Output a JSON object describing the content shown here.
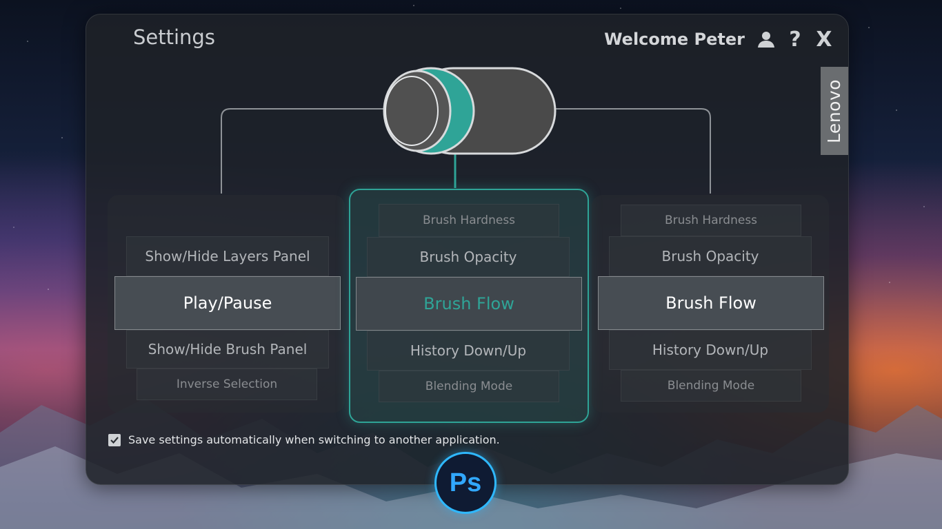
{
  "header": {
    "title": "Settings",
    "welcome": "Welcome Peter",
    "help_glyph": "?",
    "close_glyph": "X",
    "icons": [
      "user-icon",
      "help-icon",
      "close-icon"
    ]
  },
  "brand": {
    "logo_text": "Lenovo"
  },
  "dial": {
    "accent_color": "#2fa497",
    "body_color": "#4a4a4a"
  },
  "columns": {
    "left": {
      "items": [
        {
          "label": "Show/Hide Layers Panel"
        },
        {
          "label": "Play/Pause"
        },
        {
          "label": "Show/Hide Brush Panel"
        },
        {
          "label": "Inverse Selection"
        }
      ],
      "selected_index": 1
    },
    "center": {
      "items": [
        {
          "label": "Brush Hardness"
        },
        {
          "label": "Brush Opacity"
        },
        {
          "label": "Brush Flow"
        },
        {
          "label": "History Down/Up"
        },
        {
          "label": "Blending Mode"
        }
      ],
      "selected_index": 2,
      "active": true
    },
    "right": {
      "items": [
        {
          "label": "Brush Hardness"
        },
        {
          "label": "Brush Opacity"
        },
        {
          "label": "Brush Flow"
        },
        {
          "label": "History Down/Up"
        },
        {
          "label": "Blending Mode"
        }
      ],
      "selected_index": 2
    }
  },
  "autosave": {
    "checked": true,
    "label": "Save settings automatically when switching to another application."
  },
  "app_badge": {
    "text": "Ps",
    "color": "#31a8ff"
  },
  "colors": {
    "accent": "#2fa497",
    "panel": "#1e2228"
  }
}
